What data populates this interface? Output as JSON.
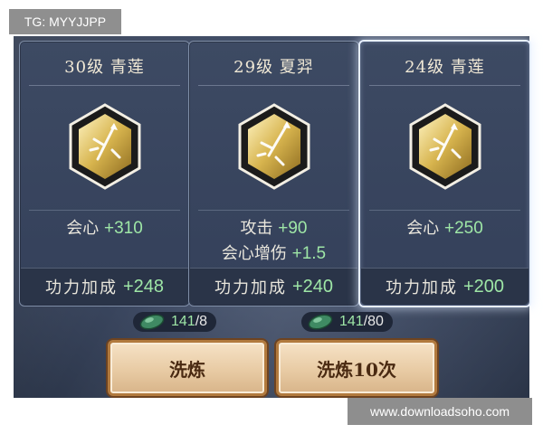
{
  "tag": "TG: MYYJJPP",
  "watermark": "www.downloadsoho.com",
  "cards": [
    {
      "title": "30级 青莲",
      "stats": [
        {
          "name": "会心",
          "value": "+310"
        }
      ],
      "bonus": {
        "label": "功力加成",
        "value": "+248"
      },
      "selected": false,
      "icon": "sword-burst-emblem"
    },
    {
      "title": "29级 夏羿",
      "stats": [
        {
          "name": "攻击",
          "value": "+90"
        },
        {
          "name": "会心增伤",
          "value": "+1.5"
        }
      ],
      "bonus": {
        "label": "功力加成",
        "value": "+240"
      },
      "selected": false,
      "icon": "sword-burst-emblem"
    },
    {
      "title": "24级 青莲",
      "stats": [
        {
          "name": "会心",
          "value": "+250"
        }
      ],
      "bonus": {
        "label": "功力加成",
        "value": "+200"
      },
      "selected": true,
      "icon": "sword-burst-emblem"
    }
  ],
  "costs": [
    {
      "have": "141",
      "need": "/8",
      "icon": "jade-gem-icon"
    },
    {
      "have": "141",
      "need": "/80",
      "icon": "jade-gem-icon"
    }
  ],
  "buttons": {
    "refine": "洗炼",
    "refine10": "洗炼10次"
  },
  "colors": {
    "stat_value": "#9ee6a6",
    "title_text": "#f1e9d6",
    "button_text": "#4a2a12"
  }
}
